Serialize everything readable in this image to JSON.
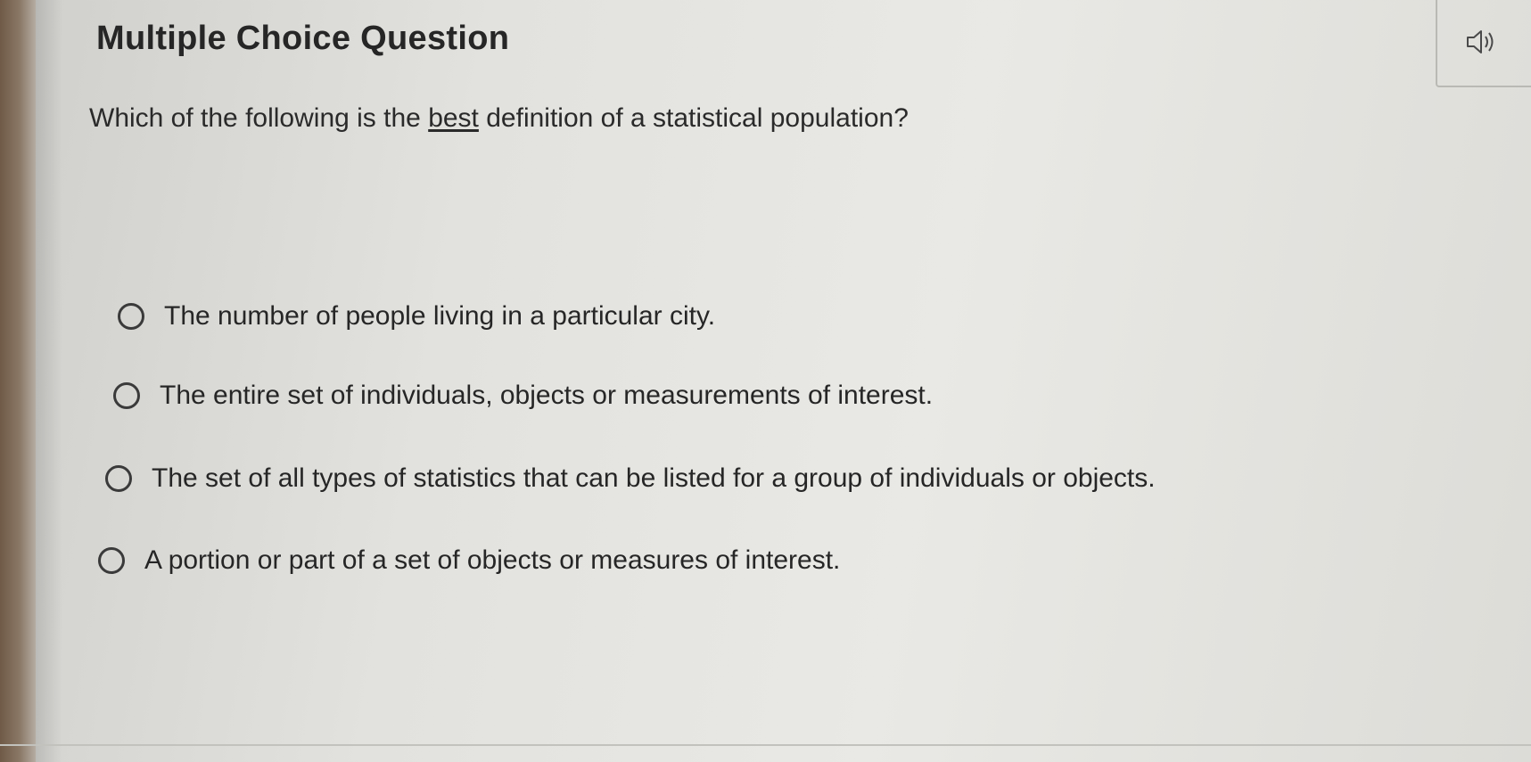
{
  "question": {
    "type_title": "Multiple Choice Question",
    "prompt_before": "Which of the following is the ",
    "prompt_emphasis": "best",
    "prompt_after": " definition of a statistical population?",
    "audio_icon": "speaker-icon"
  },
  "options": [
    {
      "label": "The number of people living in a particular city.",
      "selected": false
    },
    {
      "label": "The entire set of individuals, objects or measurements of interest.",
      "selected": false
    },
    {
      "label": "The set of all types of statistics that can be listed for a group of individuals or objects.",
      "selected": false
    },
    {
      "label": "A portion or part of a set of objects or measures of interest.",
      "selected": false
    }
  ]
}
